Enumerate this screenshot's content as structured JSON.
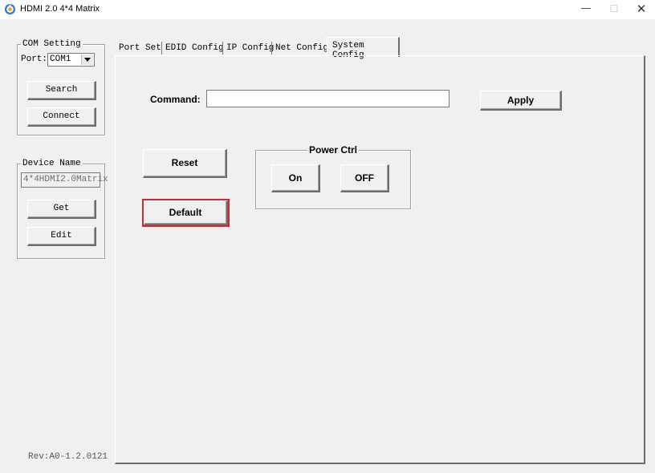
{
  "window": {
    "title": "HDMI 2.0 4*4 Matrix",
    "minimize_icon": "minimize-icon",
    "maximize_icon": "maximize-icon",
    "close_icon": "close-icon"
  },
  "com_setting": {
    "legend": "COM Setting",
    "port_label": "Port:",
    "port_value": "COM1",
    "search_label": "Search",
    "connect_label": "Connect"
  },
  "device_name": {
    "legend": "Device Name",
    "value": "4*4HDMI2.0Matrix",
    "get_label": "Get",
    "edit_label": "Edit"
  },
  "revision": "Rev:A0-1.2.0121",
  "tabs": [
    {
      "label": "Port Set"
    },
    {
      "label": "EDID Config"
    },
    {
      "label": "IP Config"
    },
    {
      "label": "Net Config"
    },
    {
      "label": "System Config",
      "active": true
    }
  ],
  "system_config": {
    "command_label": "Command:",
    "command_value": "",
    "apply_label": "Apply",
    "reset_label": "Reset",
    "default_label": "Default",
    "power_ctrl": {
      "legend": "Power Ctrl",
      "on_label": "On",
      "off_label": "OFF"
    }
  },
  "colors": {
    "highlight": "#e0202a",
    "background": "#f0f0f0"
  }
}
